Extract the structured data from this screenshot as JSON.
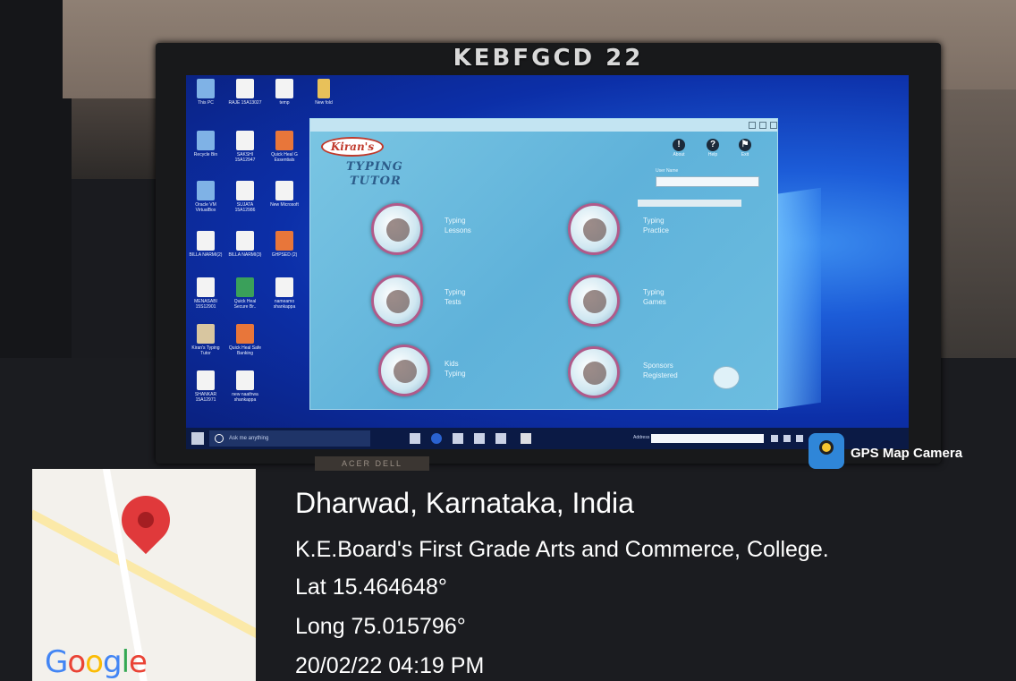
{
  "monitor": {
    "brand_label": "KEBFGCD 22"
  },
  "desktop": {
    "icons": [
      {
        "label": "This PC",
        "icon": "computer-icon"
      },
      {
        "label": "RAJE\n15A13027",
        "icon": "file-icon"
      },
      {
        "label": "temp",
        "icon": "file-icon"
      },
      {
        "label": "New fold",
        "icon": "folder-icon"
      },
      {
        "label": "Recycle Bin",
        "icon": "recycle-bin-icon"
      },
      {
        "label": "SAKSHI\n15A12947",
        "icon": "file-icon"
      },
      {
        "label": "Quick Heal G\nEssentials",
        "icon": "quick-heal-icon"
      },
      {
        "label": "Oracle VM\nVirtualBox",
        "icon": "virtualbox-icon"
      },
      {
        "label": "SUJATA\n15A12986",
        "icon": "file-icon"
      },
      {
        "label": "New\nMicrosoft",
        "icon": "file-icon"
      },
      {
        "label": "BILLA\nNARMI(2)",
        "icon": "file-icon"
      },
      {
        "label": "BILLA\nNARMI(3)",
        "icon": "file-icon"
      },
      {
        "label": "GHPSED (2)",
        "icon": "app-icon"
      },
      {
        "label": "MENASABI\n15S12901",
        "icon": "file-icon"
      },
      {
        "label": "Quick Heal\nSecure Br..",
        "icon": "quick-heal-secure-icon"
      },
      {
        "label": "nameamo\nshankappa",
        "icon": "file-icon"
      },
      {
        "label": "Kiran's\nTyping Tutor",
        "icon": "typing-tutor-icon"
      },
      {
        "label": "Quick Heal\nSafe Banking",
        "icon": "safe-banking-icon"
      },
      {
        "label": "SHANKAR\n15A12971",
        "icon": "file-icon"
      },
      {
        "label": "new naathwa\nshankappa",
        "icon": "file-icon"
      }
    ]
  },
  "typing_tutor": {
    "logo_text": "Kiran's",
    "heading_line1": "TYPING",
    "heading_line2": "TUTOR",
    "header_buttons": [
      {
        "glyph": "!",
        "label": "About"
      },
      {
        "glyph": "?",
        "label": "Help"
      },
      {
        "glyph": "⚑",
        "label": "Exit"
      }
    ],
    "user_label": "User Name",
    "options": [
      {
        "label_line1": "Typing",
        "label_line2": "Lessons"
      },
      {
        "label_line1": "Typing",
        "label_line2": "Practice"
      },
      {
        "label_line1": "Typing",
        "label_line2": "Tests"
      },
      {
        "label_line1": "Typing",
        "label_line2": "Games"
      },
      {
        "label_line1": "Kids",
        "label_line2": "Typing"
      },
      {
        "label_line1": "Sponsors",
        "label_line2": "Registered"
      }
    ]
  },
  "taskbar": {
    "search_placeholder": "Ask me anything",
    "tray_text": "Address"
  },
  "stand_label": "ACER DELL",
  "gps_overlay": {
    "app_name": "GPS Map Camera",
    "map_provider": "Google",
    "location": "Dharwad, Karnataka, India",
    "place": "K.E.Board's First Grade Arts and Commerce, College.",
    "latitude": "Lat 15.464648°",
    "longitude": "Long 75.015796°",
    "datetime": "20/02/22 04:19 PM"
  }
}
